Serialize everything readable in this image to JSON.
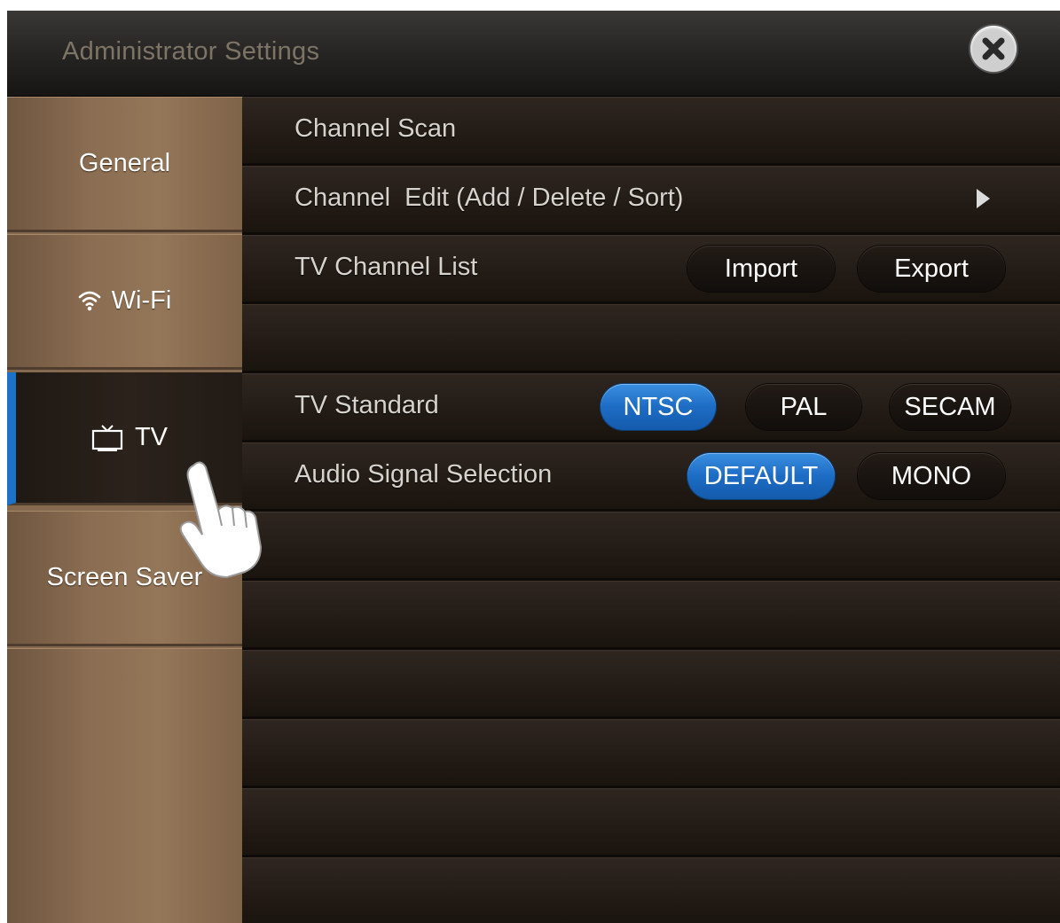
{
  "window": {
    "title": "Administrator Settings",
    "close_icon": "close-icon"
  },
  "sidebar": {
    "items": [
      {
        "label": "General",
        "icon": "",
        "active": false
      },
      {
        "label": "Wi-Fi",
        "icon": "wifi-icon",
        "active": false
      },
      {
        "label": "TV",
        "icon": "tv-icon",
        "active": true
      },
      {
        "label": "Screen Saver",
        "icon": "",
        "active": false
      }
    ]
  },
  "main": {
    "channel_scan": "Channel Scan",
    "channel_edit": "Channel  Edit (Add / Delete / Sort)",
    "tv_channel_list": {
      "label": "TV Channel List",
      "import_label": "Import",
      "export_label": "Export"
    },
    "tv_standard": {
      "label": "TV Standard",
      "options": [
        "NTSC",
        "PAL",
        "SECAM"
      ],
      "selected": "NTSC"
    },
    "audio_signal": {
      "label": "Audio Signal Selection",
      "options": [
        "DEFAULT",
        "MONO"
      ],
      "selected": "DEFAULT"
    }
  },
  "colors": {
    "accent": "#1b72c7",
    "sidebar": "#866a4f",
    "row": "#201913"
  }
}
